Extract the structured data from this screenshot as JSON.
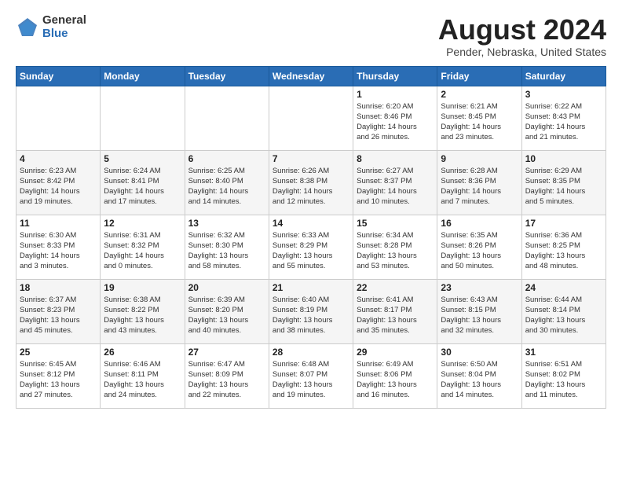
{
  "header": {
    "logo_general": "General",
    "logo_blue": "Blue",
    "title": "August 2024",
    "subtitle": "Pender, Nebraska, United States"
  },
  "weekdays": [
    "Sunday",
    "Monday",
    "Tuesday",
    "Wednesday",
    "Thursday",
    "Friday",
    "Saturday"
  ],
  "weeks": [
    [
      {
        "day": "",
        "info": ""
      },
      {
        "day": "",
        "info": ""
      },
      {
        "day": "",
        "info": ""
      },
      {
        "day": "",
        "info": ""
      },
      {
        "day": "1",
        "info": "Sunrise: 6:20 AM\nSunset: 8:46 PM\nDaylight: 14 hours\nand 26 minutes."
      },
      {
        "day": "2",
        "info": "Sunrise: 6:21 AM\nSunset: 8:45 PM\nDaylight: 14 hours\nand 23 minutes."
      },
      {
        "day": "3",
        "info": "Sunrise: 6:22 AM\nSunset: 8:43 PM\nDaylight: 14 hours\nand 21 minutes."
      }
    ],
    [
      {
        "day": "4",
        "info": "Sunrise: 6:23 AM\nSunset: 8:42 PM\nDaylight: 14 hours\nand 19 minutes."
      },
      {
        "day": "5",
        "info": "Sunrise: 6:24 AM\nSunset: 8:41 PM\nDaylight: 14 hours\nand 17 minutes."
      },
      {
        "day": "6",
        "info": "Sunrise: 6:25 AM\nSunset: 8:40 PM\nDaylight: 14 hours\nand 14 minutes."
      },
      {
        "day": "7",
        "info": "Sunrise: 6:26 AM\nSunset: 8:38 PM\nDaylight: 14 hours\nand 12 minutes."
      },
      {
        "day": "8",
        "info": "Sunrise: 6:27 AM\nSunset: 8:37 PM\nDaylight: 14 hours\nand 10 minutes."
      },
      {
        "day": "9",
        "info": "Sunrise: 6:28 AM\nSunset: 8:36 PM\nDaylight: 14 hours\nand 7 minutes."
      },
      {
        "day": "10",
        "info": "Sunrise: 6:29 AM\nSunset: 8:35 PM\nDaylight: 14 hours\nand 5 minutes."
      }
    ],
    [
      {
        "day": "11",
        "info": "Sunrise: 6:30 AM\nSunset: 8:33 PM\nDaylight: 14 hours\nand 3 minutes."
      },
      {
        "day": "12",
        "info": "Sunrise: 6:31 AM\nSunset: 8:32 PM\nDaylight: 14 hours\nand 0 minutes."
      },
      {
        "day": "13",
        "info": "Sunrise: 6:32 AM\nSunset: 8:30 PM\nDaylight: 13 hours\nand 58 minutes."
      },
      {
        "day": "14",
        "info": "Sunrise: 6:33 AM\nSunset: 8:29 PM\nDaylight: 13 hours\nand 55 minutes."
      },
      {
        "day": "15",
        "info": "Sunrise: 6:34 AM\nSunset: 8:28 PM\nDaylight: 13 hours\nand 53 minutes."
      },
      {
        "day": "16",
        "info": "Sunrise: 6:35 AM\nSunset: 8:26 PM\nDaylight: 13 hours\nand 50 minutes."
      },
      {
        "day": "17",
        "info": "Sunrise: 6:36 AM\nSunset: 8:25 PM\nDaylight: 13 hours\nand 48 minutes."
      }
    ],
    [
      {
        "day": "18",
        "info": "Sunrise: 6:37 AM\nSunset: 8:23 PM\nDaylight: 13 hours\nand 45 minutes."
      },
      {
        "day": "19",
        "info": "Sunrise: 6:38 AM\nSunset: 8:22 PM\nDaylight: 13 hours\nand 43 minutes."
      },
      {
        "day": "20",
        "info": "Sunrise: 6:39 AM\nSunset: 8:20 PM\nDaylight: 13 hours\nand 40 minutes."
      },
      {
        "day": "21",
        "info": "Sunrise: 6:40 AM\nSunset: 8:19 PM\nDaylight: 13 hours\nand 38 minutes."
      },
      {
        "day": "22",
        "info": "Sunrise: 6:41 AM\nSunset: 8:17 PM\nDaylight: 13 hours\nand 35 minutes."
      },
      {
        "day": "23",
        "info": "Sunrise: 6:43 AM\nSunset: 8:15 PM\nDaylight: 13 hours\nand 32 minutes."
      },
      {
        "day": "24",
        "info": "Sunrise: 6:44 AM\nSunset: 8:14 PM\nDaylight: 13 hours\nand 30 minutes."
      }
    ],
    [
      {
        "day": "25",
        "info": "Sunrise: 6:45 AM\nSunset: 8:12 PM\nDaylight: 13 hours\nand 27 minutes."
      },
      {
        "day": "26",
        "info": "Sunrise: 6:46 AM\nSunset: 8:11 PM\nDaylight: 13 hours\nand 24 minutes."
      },
      {
        "day": "27",
        "info": "Sunrise: 6:47 AM\nSunset: 8:09 PM\nDaylight: 13 hours\nand 22 minutes."
      },
      {
        "day": "28",
        "info": "Sunrise: 6:48 AM\nSunset: 8:07 PM\nDaylight: 13 hours\nand 19 minutes."
      },
      {
        "day": "29",
        "info": "Sunrise: 6:49 AM\nSunset: 8:06 PM\nDaylight: 13 hours\nand 16 minutes."
      },
      {
        "day": "30",
        "info": "Sunrise: 6:50 AM\nSunset: 8:04 PM\nDaylight: 13 hours\nand 14 minutes."
      },
      {
        "day": "31",
        "info": "Sunrise: 6:51 AM\nSunset: 8:02 PM\nDaylight: 13 hours\nand 11 minutes."
      }
    ]
  ]
}
